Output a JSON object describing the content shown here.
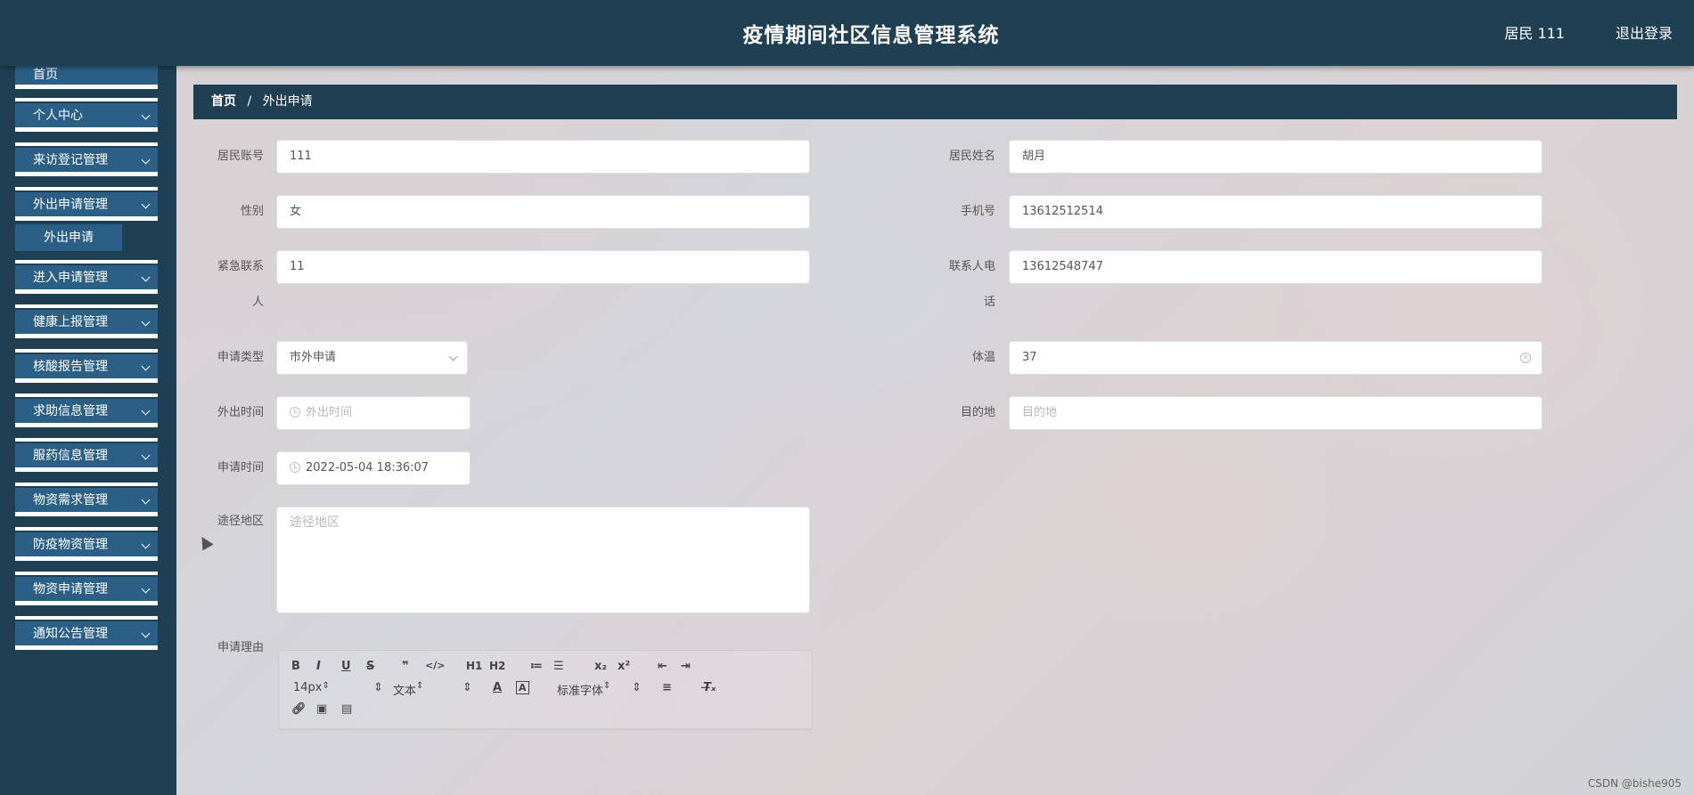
{
  "header": {
    "title": "疫情期间社区信息管理系统",
    "user": "居民 111",
    "logout": "退出登录"
  },
  "sidebar": {
    "items": [
      {
        "label": "首页"
      },
      {
        "label": "个人中心"
      },
      {
        "label": "来访登记管理"
      },
      {
        "label": "外出申请管理"
      },
      {
        "label": "进入申请管理"
      },
      {
        "label": "健康上报管理"
      },
      {
        "label": "核酸报告管理"
      },
      {
        "label": "求助信息管理"
      },
      {
        "label": "服药信息管理"
      },
      {
        "label": "物资需求管理"
      },
      {
        "label": "防疫物资管理"
      },
      {
        "label": "物资申请管理"
      },
      {
        "label": "通知公告管理"
      }
    ],
    "sub_item": "外出申请"
  },
  "breadcrumb": {
    "home": "首页",
    "sep": "/",
    "current": "外出申请"
  },
  "form": {
    "account_label": "居民账号",
    "account_value": "111",
    "name_label": "居民姓名",
    "name_value": "胡月",
    "gender_label": "性别",
    "gender_value": "女",
    "phone_label": "手机号",
    "phone_value": "13612512514",
    "emergency_label_1": "紧急联系",
    "emergency_label_2": "人",
    "emergency_value": "11",
    "contact_phone_label_1": "联系人电",
    "contact_phone_label_2": "话",
    "contact_phone_value": "13612548747",
    "type_label": "申请类型",
    "type_value": "市外申请",
    "temp_label": "体温",
    "temp_value": "37",
    "out_time_label": "外出时间",
    "out_time_placeholder": "外出时间",
    "dest_label": "目的地",
    "dest_placeholder": "目的地",
    "apply_time_label": "申请时间",
    "apply_time_value": "2022-05-04 18:36:07",
    "route_label": "途径地区",
    "route_placeholder": "途径地区",
    "reason_label": "申请理由"
  },
  "editor": {
    "font_size": "14px",
    "text_style": "文本",
    "font_family": "标准字体",
    "buttons": [
      "B",
      "I",
      "U",
      "S",
      "❞",
      "</>",
      "H1",
      "H2",
      "≔",
      "☰",
      "x₂",
      "x²",
      "⇤",
      "⇥"
    ]
  },
  "watermark": "CSDN @bishe905"
}
